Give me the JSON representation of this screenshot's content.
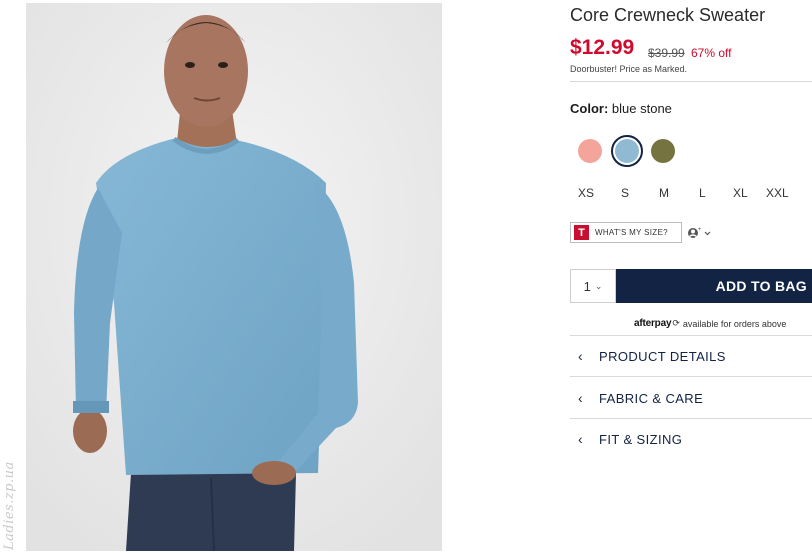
{
  "watermark": "Ladies.zp.ua",
  "product": {
    "title": "Core Crewneck Sweater",
    "price": "$12.99",
    "original_price": "$39.99",
    "discount": "67% off",
    "promo_note": "Doorbuster! Price as Marked.",
    "image_icon": "product-photo-model-sweater"
  },
  "color": {
    "label": "Color:",
    "selected_name": "blue stone",
    "swatches": [
      {
        "name": "pink",
        "hex": "#f3a49b",
        "selected": false
      },
      {
        "name": "blue stone",
        "hex": "#8fbad2",
        "selected": true
      },
      {
        "name": "olive",
        "hex": "#75733f",
        "selected": false
      }
    ]
  },
  "sizes": [
    "XS",
    "S",
    "M",
    "L",
    "XL",
    "XXL"
  ],
  "fit": {
    "logo_letter": "T",
    "label": "WHAT'S MY SIZE?",
    "profile_icon": "user-profile-icon"
  },
  "cart": {
    "quantity": "1",
    "add_label": "ADD TO BAG"
  },
  "afterpay": {
    "brand": "afterpay",
    "text": "available for orders above"
  },
  "accordions": [
    {
      "label": "PRODUCT DETAILS"
    },
    {
      "label": "FABRIC & CARE"
    },
    {
      "label": "FIT & SIZING"
    }
  ],
  "colors": {
    "sale_red": "#d00a2c",
    "navy": "#122344",
    "sweater_blue": "#7fb0cf"
  }
}
